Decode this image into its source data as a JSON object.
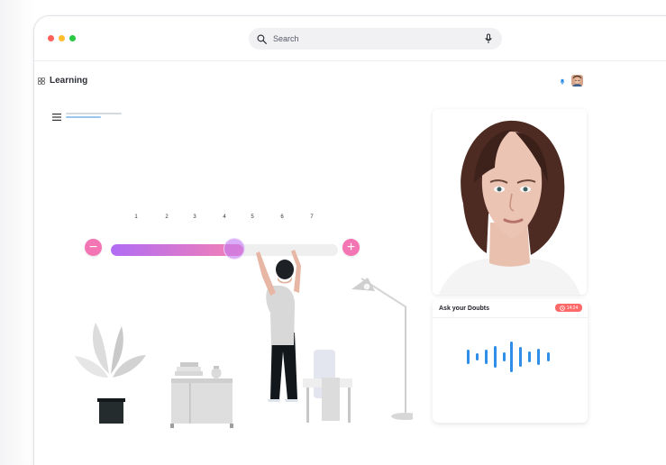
{
  "window": {
    "traffic_lights": [
      {
        "name": "close",
        "color": "#ff5f57"
      },
      {
        "name": "minimize",
        "color": "#ffbd2e"
      },
      {
        "name": "maximize",
        "color": "#28c840"
      }
    ],
    "search": {
      "label": "Search",
      "icon": "search-icon",
      "mic_icon": "microphone-icon"
    }
  },
  "header": {
    "title": "Learning",
    "brand_icon": "grid-icon",
    "notification_icon": "bell-icon",
    "avatar_icon": "user-avatar"
  },
  "toolbar": {
    "menu_icon": "hamburger-icon"
  },
  "slider": {
    "scale": [
      "1",
      "2",
      "3",
      "4",
      "5",
      "6",
      "7"
    ],
    "minus_label": "−",
    "plus_label": "+",
    "value": 4.5,
    "min": 1,
    "max": 7,
    "colors": {
      "start": "#b06cf4",
      "end": "#f680b4",
      "buttons": "#f475b4"
    }
  },
  "video": {
    "subject": "person-video-feed"
  },
  "doubts": {
    "title": "Ask your Doubts",
    "timer_icon": "clock-icon",
    "time": "14:24",
    "wave_icon": "audio-wave-icon",
    "accent": "#2f8fe8",
    "timer_color": "#ff6b6b"
  }
}
